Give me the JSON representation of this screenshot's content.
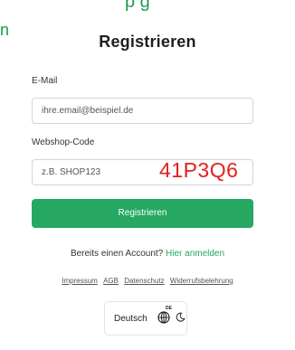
{
  "top_fragments": {
    "fragment_a": "p     g",
    "fragment_b": "n"
  },
  "page": {
    "title": "Registrieren"
  },
  "form": {
    "email_label": "E-Mail",
    "email_placeholder": "ihre.email@beispiel.de",
    "code_label": "Webshop-Code",
    "code_placeholder": "z.B. SHOP123",
    "code_overlay": "41P3Q6",
    "submit_label": "Registrieren"
  },
  "account": {
    "prompt": "Bereits einen Account?",
    "login_link": "Hier anmelden"
  },
  "footer": {
    "links": [
      "Impressum",
      "AGB",
      "Datenschutz",
      "Widerrufsbelehrung"
    ]
  },
  "language": {
    "label": "Deutsch",
    "code": "DE",
    "globe_icon": "globe-icon",
    "theme_icon": "theme-toggle-icon"
  },
  "colors": {
    "accent": "#26a862",
    "overlay_red": "#e0201b",
    "top_text": "#1a9e4a"
  }
}
